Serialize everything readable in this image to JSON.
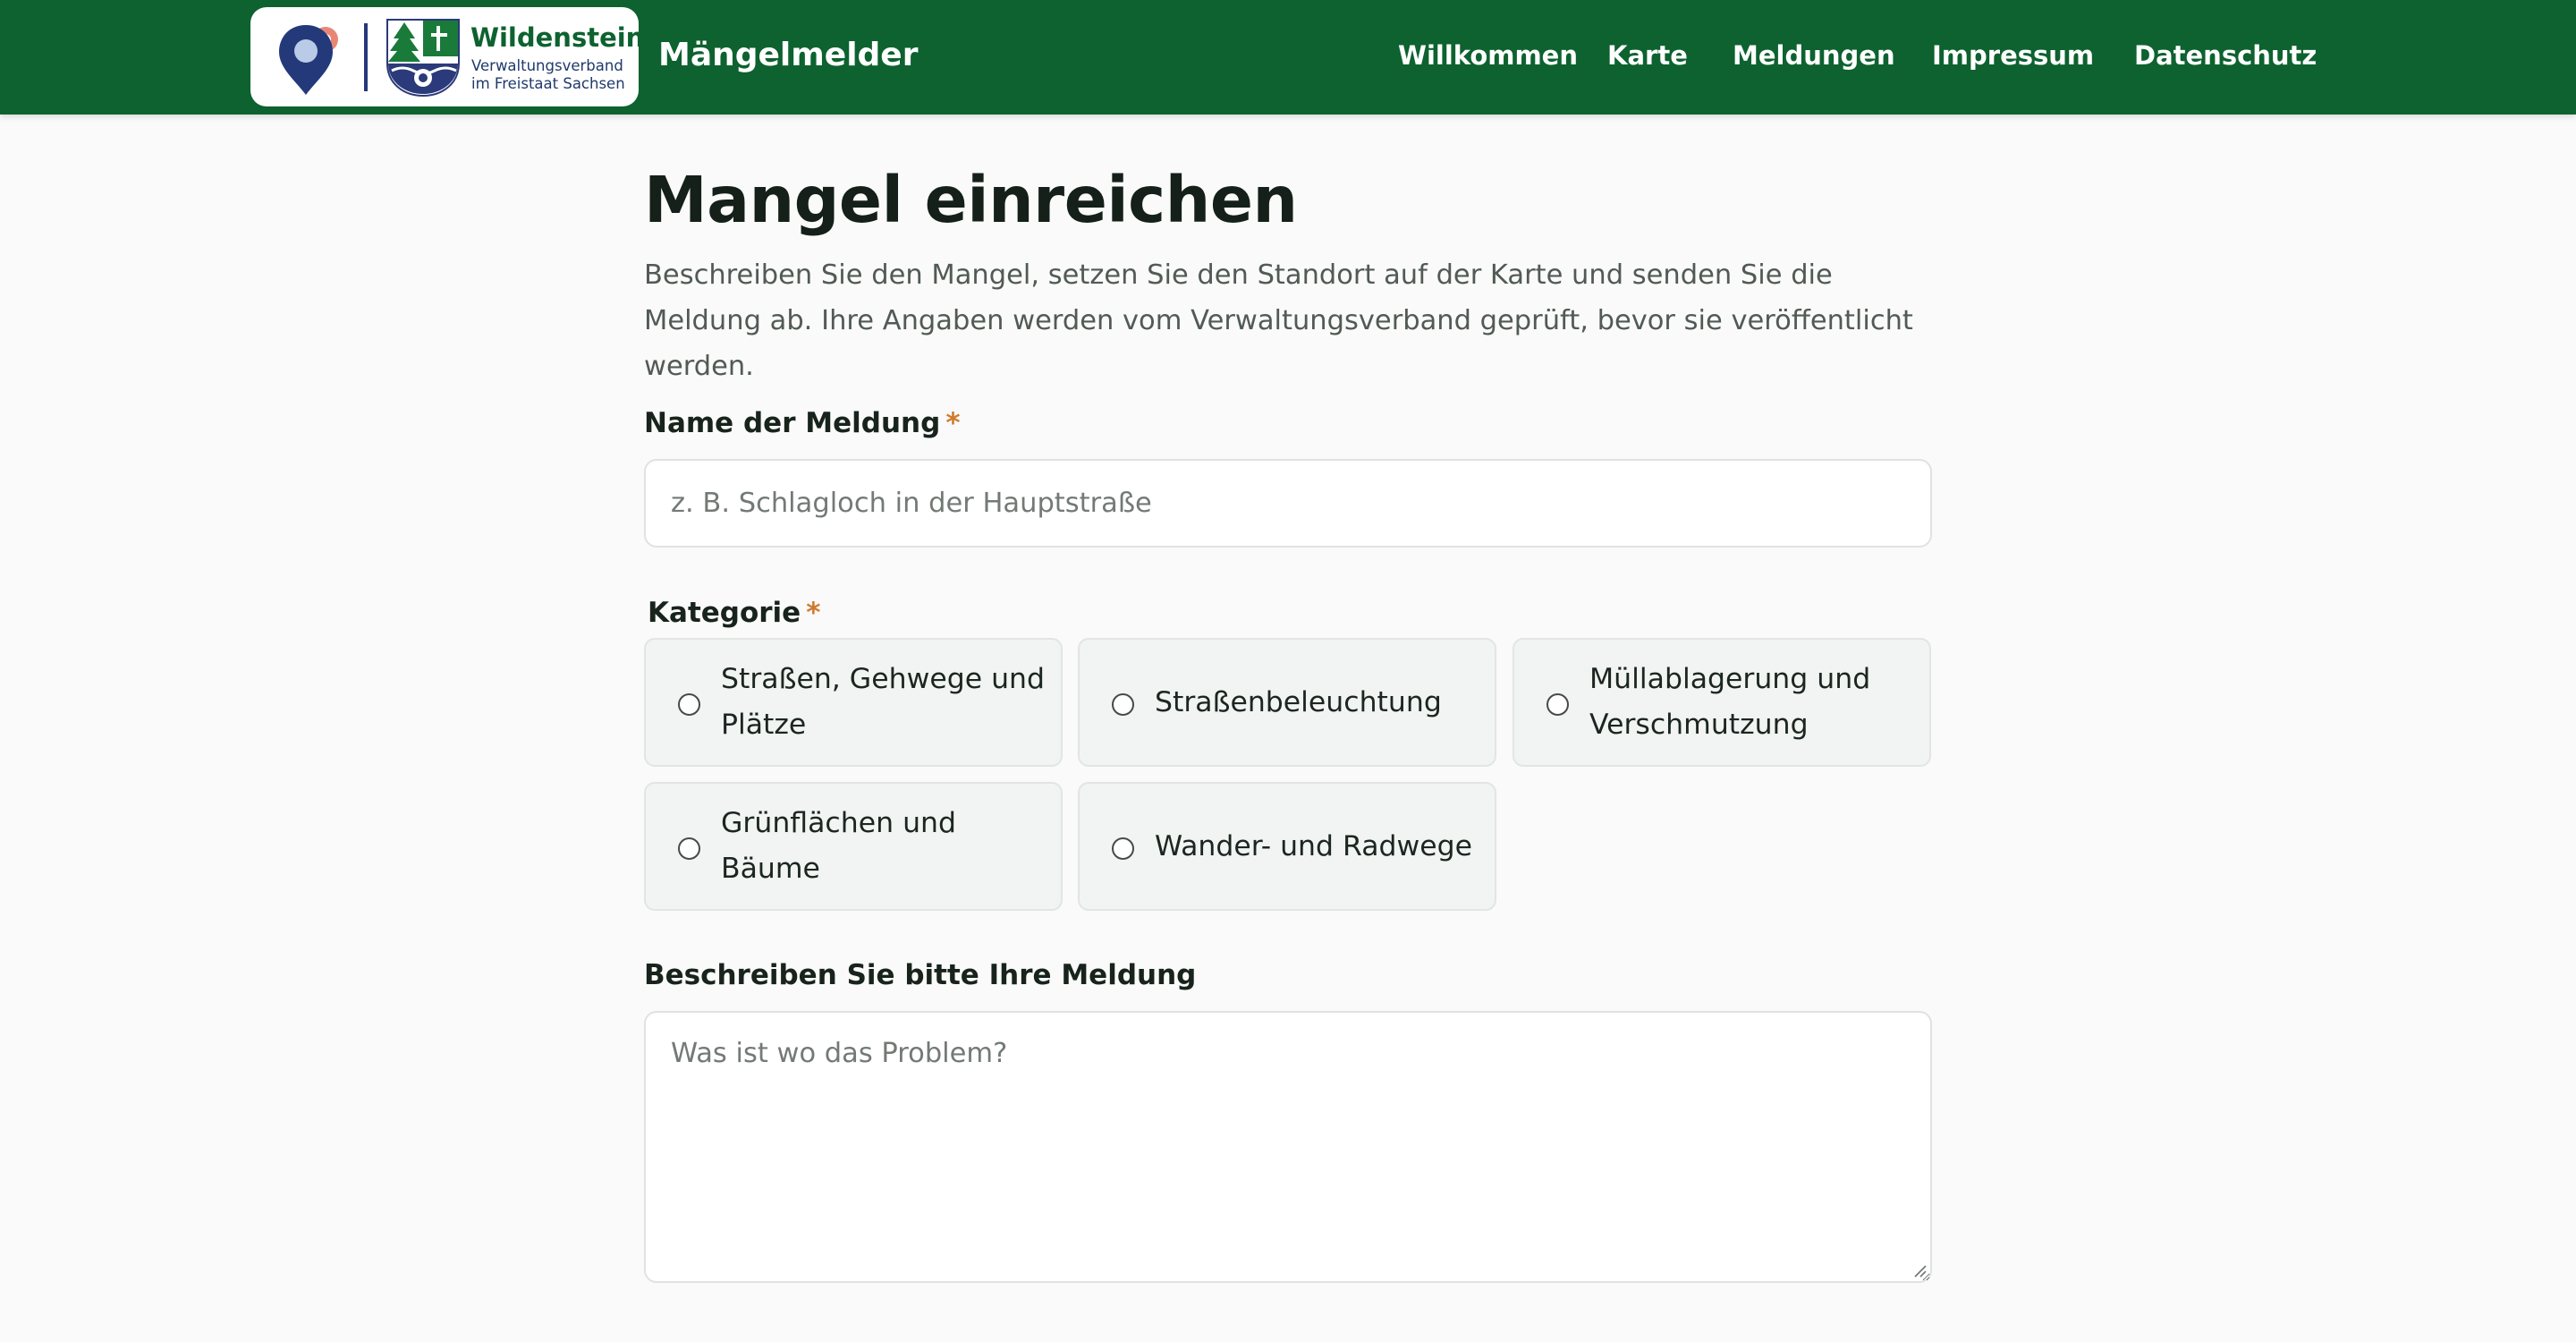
{
  "header": {
    "brand_name": "Wildenstein",
    "brand_sub_line1": "Verwaltungsverband",
    "brand_sub_line2": "im Freistaat Sachsen",
    "app_title": "Mängelmelder",
    "nav": [
      {
        "label": "Willkommen"
      },
      {
        "label": "Karte"
      },
      {
        "label": "Meldungen"
      },
      {
        "label": "Impressum"
      },
      {
        "label": "Datenschutz"
      }
    ],
    "colors": {
      "bar": "#0d622f",
      "pin": "#23397a",
      "pin_accent": "#e98776"
    }
  },
  "main": {
    "title": "Mangel einreichen",
    "intro": "Beschreiben Sie den Mangel, setzen Sie den Standort auf der Karte und senden Sie die Meldung ab. Ihre Angaben werden vom Verwaltungsverband geprüft, bevor sie veröffentlicht werden.",
    "name_field": {
      "label": "Name der Meldung",
      "required_mark": "*",
      "placeholder": "z. B. Schlagloch in der Hauptstraße",
      "value": ""
    },
    "category": {
      "label": "Kategorie",
      "required_mark": "*",
      "options": [
        {
          "label": "Straßen, Gehwege und Plätze",
          "selected": false
        },
        {
          "label": "Straßenbeleuchtung",
          "selected": false
        },
        {
          "label": "Müllablagerung und Verschmutzung",
          "selected": false
        },
        {
          "label": "Grünflächen und Bäume",
          "selected": false
        },
        {
          "label": "Wander- und Radwege",
          "selected": false
        }
      ]
    },
    "description": {
      "label": "Beschreiben Sie bitte Ihre Meldung",
      "placeholder": "Was ist wo das Problem?",
      "value": ""
    }
  }
}
